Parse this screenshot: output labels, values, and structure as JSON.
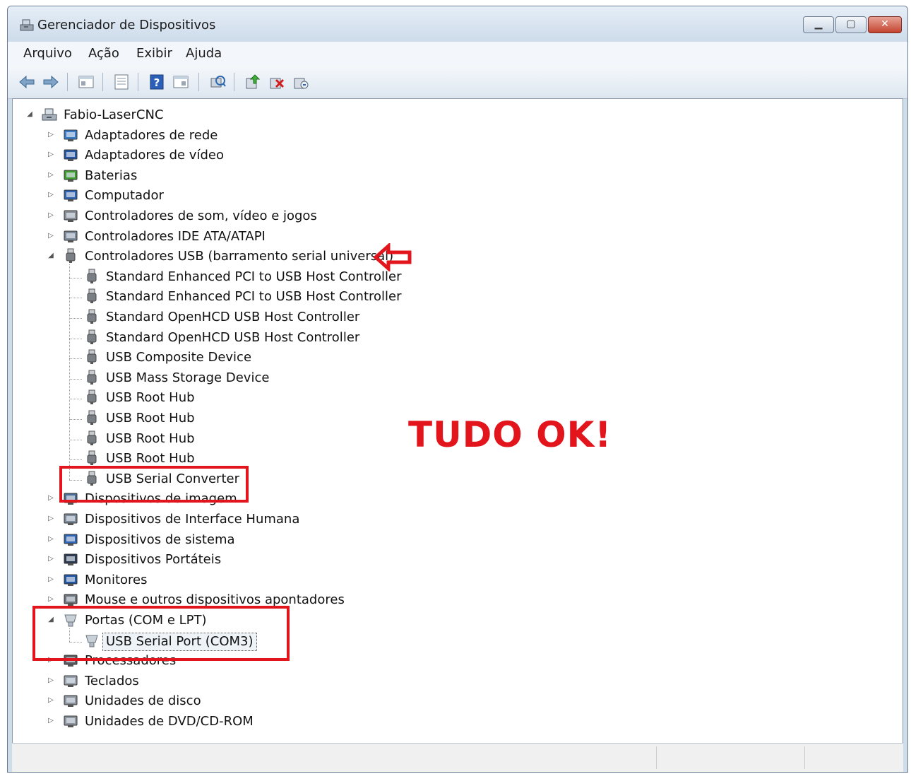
{
  "window": {
    "title": "Gerenciador de Dispositivos"
  },
  "menu": [
    "Arquivo",
    "Ação",
    "Exibir",
    "Ajuda"
  ],
  "toolbar": [
    "back-icon",
    "forward-icon",
    "properties-pane-icon",
    "list-view-icon",
    "help-icon",
    "properties-icon",
    "scan-hardware-icon",
    "update-driver-icon",
    "uninstall-icon",
    "disable-icon"
  ],
  "tree": {
    "root": "Fabio-LaserCNC",
    "categories_before": [
      {
        "label": "Adaptadores de rede",
        "icon": "network-adapter-icon"
      },
      {
        "label": "Adaptadores de vídeo",
        "icon": "display-adapter-icon"
      },
      {
        "label": "Baterias",
        "icon": "battery-icon"
      },
      {
        "label": "Computador",
        "icon": "computer-icon"
      },
      {
        "label": "Controladores de som, vídeo e jogos",
        "icon": "sound-icon"
      },
      {
        "label": "Controladores IDE ATA/ATAPI",
        "icon": "ide-controller-icon"
      }
    ],
    "usb": {
      "label": "Controladores USB (barramento serial universal)",
      "children": [
        "Standard Enhanced PCI to USB Host Controller",
        "Standard Enhanced PCI to USB Host Controller",
        "Standard OpenHCD USB Host Controller",
        "Standard OpenHCD USB Host Controller",
        "USB Composite Device",
        "USB Mass Storage Device",
        "USB Root Hub",
        "USB Root Hub",
        "USB Root Hub",
        "USB Root Hub",
        "USB Serial Converter"
      ]
    },
    "categories_middle": [
      {
        "label": "Dispositivos de imagem",
        "icon": "imaging-icon"
      },
      {
        "label": "Dispositivos de Interface Humana",
        "icon": "hid-icon"
      },
      {
        "label": "Dispositivos de sistema",
        "icon": "system-device-icon"
      },
      {
        "label": "Dispositivos Portáteis",
        "icon": "portable-device-icon"
      },
      {
        "label": "Monitores",
        "icon": "monitor-icon"
      },
      {
        "label": "Mouse e outros dispositivos apontadores",
        "icon": "mouse-icon"
      }
    ],
    "ports": {
      "label": "Portas (COM e LPT)",
      "children": [
        "USB Serial Port (COM3)"
      ]
    },
    "categories_after": [
      {
        "label": "Processadores",
        "icon": "processor-icon"
      },
      {
        "label": "Teclados",
        "icon": "keyboard-icon"
      },
      {
        "label": "Unidades de disco",
        "icon": "disk-drive-icon"
      },
      {
        "label": "Unidades de DVD/CD-ROM",
        "icon": "dvd-drive-icon"
      }
    ]
  },
  "annotation": {
    "text": "TUDO OK!",
    "color": "#e3151c"
  }
}
